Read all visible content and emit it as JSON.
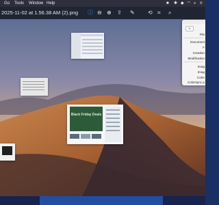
{
  "menubar": {
    "items": [
      "Go",
      "Tools",
      "Window",
      "Help"
    ],
    "status_icons": [
      "stop-icon",
      "bluetooth-icon",
      "shield-icon",
      "wifi-icon",
      "search-icon",
      "control-center-icon"
    ]
  },
  "toolbar": {
    "title": "2025-11-02 at 1.56.38 AM (2).png",
    "buttons": [
      "info-icon",
      "zoom-out-icon",
      "zoom-in-icon",
      "share-icon",
      "markup-icon",
      "rotate-icon",
      "crop-icon",
      "search-icon"
    ]
  },
  "thumbnails": {
    "promo_text": "Black Friday Deals"
  },
  "inspector": {
    "labels": [
      "File",
      "Document",
      "F",
      "Creation",
      "Modification",
      "Imag",
      "Imag",
      "Color",
      "ColorSync p"
    ]
  },
  "colors": {
    "accent": "#4aa3ff",
    "menubar": "#2e2f3d",
    "toolbar": "#1f2533"
  }
}
